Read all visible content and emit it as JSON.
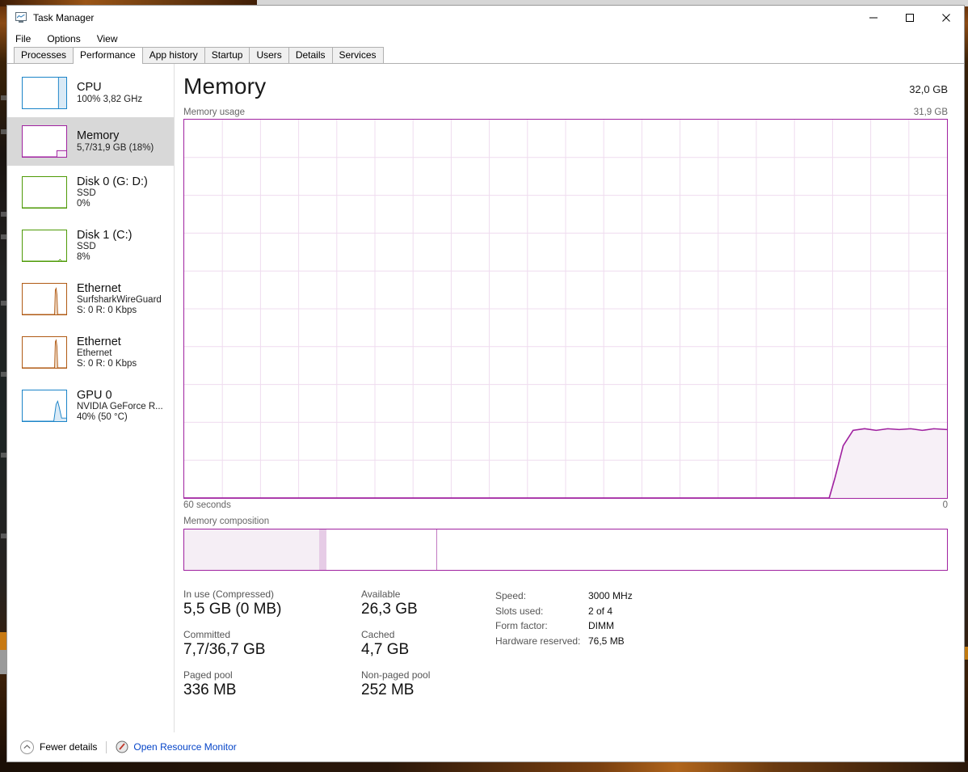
{
  "window": {
    "title": "Task Manager",
    "icon": "task-manager-icon",
    "controls": {
      "minimize": "–",
      "maximize": "□",
      "close": "✕"
    }
  },
  "menu": {
    "items": [
      "File",
      "Options",
      "View"
    ]
  },
  "tabs": {
    "items": [
      "Processes",
      "Performance",
      "App history",
      "Startup",
      "Users",
      "Details",
      "Services"
    ],
    "active": "Performance"
  },
  "sidebar": {
    "items": [
      {
        "name": "CPU",
        "line1": "100%  3,82 GHz",
        "line2": "",
        "color": "#1b84c8",
        "thumb": "cpu-thumb"
      },
      {
        "name": "Memory",
        "line1": "5,7/31,9 GB (18%)",
        "line2": "",
        "color": "#a022a0",
        "thumb": "memory-thumb",
        "selected": true
      },
      {
        "name": "Disk 0 (G: D:)",
        "line1": "SSD",
        "line2": "0%",
        "color": "#4e9a06",
        "thumb": "disk0-thumb"
      },
      {
        "name": "Disk 1 (C:)",
        "line1": "SSD",
        "line2": "8%",
        "color": "#4e9a06",
        "thumb": "disk1-thumb"
      },
      {
        "name": "Ethernet",
        "line1": "SurfsharkWireGuard",
        "line2": "S: 0 R: 0 Kbps",
        "color": "#b05a14",
        "thumb": "ethernet0-thumb"
      },
      {
        "name": "Ethernet",
        "line1": "Ethernet",
        "line2": "S: 0 R: 0 Kbps",
        "color": "#b05a14",
        "thumb": "ethernet1-thumb"
      },
      {
        "name": "GPU 0",
        "line1": "NVIDIA GeForce R...",
        "line2": "40%  (50 °C)",
        "color": "#1b84c8",
        "thumb": "gpu0-thumb"
      }
    ]
  },
  "main": {
    "title": "Memory",
    "total": "32,0 GB",
    "usage_label": "Memory usage",
    "usage_max": "31,9 GB",
    "time_left": "60 seconds",
    "time_right": "0",
    "composition_label": "Memory composition"
  },
  "chart_data": {
    "type": "area",
    "title": "Memory usage",
    "xlabel": "60 seconds",
    "ylabel": "GB",
    "ylim": [
      0,
      31.9
    ],
    "xlim": [
      -60,
      0
    ],
    "grid": true,
    "grid_cols": 20,
    "grid_rows": 10,
    "series": [
      {
        "name": "In use",
        "color": "#a022a0",
        "fill": "#f5edf5",
        "x": [
          -60,
          -57,
          -54,
          -51,
          -48,
          -45,
          -42,
          -39,
          -36,
          -33,
          -30,
          -27,
          -24,
          -21,
          -18,
          -15,
          -12,
          -9,
          -8.6,
          -8.2,
          -7.5,
          -6.8,
          -6,
          -5,
          -4,
          -3,
          -2,
          -1,
          0
        ],
        "y": [
          0,
          0,
          0,
          0,
          0,
          0,
          0,
          0,
          0,
          0,
          0,
          0,
          0,
          0,
          0,
          0,
          0,
          0,
          0.9,
          2.9,
          5.2,
          5.55,
          5.6,
          5.55,
          5.62,
          5.58,
          5.55,
          5.6,
          5.62
        ]
      }
    ]
  },
  "composition": {
    "segments": [
      {
        "name": "in-use",
        "pct": 17.7,
        "fill": "#f5eef5"
      },
      {
        "name": "modified",
        "pct": 0.9,
        "fill": "#e6cce6"
      },
      {
        "name": "standby",
        "pct": 14.6,
        "fill": "#ffffff"
      },
      {
        "name": "free",
        "pct": 66.8,
        "fill": "#ffffff"
      }
    ]
  },
  "stats": {
    "col1": [
      {
        "label": "In use (Compressed)",
        "value": "5,5 GB (0 MB)"
      },
      {
        "label": "Committed",
        "value": "7,7/36,7 GB"
      },
      {
        "label": "Paged pool",
        "value": "336 MB"
      }
    ],
    "col2": [
      {
        "label": "Available",
        "value": "26,3 GB"
      },
      {
        "label": "Cached",
        "value": "4,7 GB"
      },
      {
        "label": "Non-paged pool",
        "value": "252 MB"
      }
    ],
    "info": [
      {
        "key": "Speed:",
        "value": "3000 MHz"
      },
      {
        "key": "Slots used:",
        "value": "2 of 4"
      },
      {
        "key": "Form factor:",
        "value": "DIMM"
      },
      {
        "key": "Hardware reserved:",
        "value": "76,5 MB"
      }
    ]
  },
  "footer": {
    "fewer_details": "Fewer details",
    "resource_monitor": "Open Resource Monitor"
  }
}
